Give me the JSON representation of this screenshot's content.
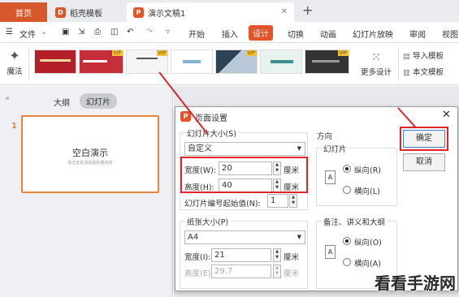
{
  "tabs": {
    "home": "首页",
    "templates": "稻壳模板",
    "doc": "演示文稿1",
    "add": "+"
  },
  "menu": {
    "file": "文件",
    "start": "开始",
    "insert": "插入",
    "design": "设计",
    "transition": "切换",
    "animation": "动画",
    "slideshow": "幻灯片放映",
    "review": "审阅",
    "view": "视图"
  },
  "ribbon": {
    "magic": "魔法",
    "vip": "VIP",
    "more": "更多设计",
    "import": "导入模板",
    "this_tpl": "本文模板"
  },
  "left": {
    "outline": "大纲",
    "slides": "幻灯片",
    "slide_num": "1",
    "slide_title": "空白演示",
    "slide_sub": "单击此处添加副标题内容"
  },
  "dialog": {
    "title": "页面设置",
    "slide_size_label": "幻灯片大小(S)",
    "slide_size_value": "自定义",
    "width_label": "宽度(W):",
    "width_value": "20",
    "height_label": "高度(H):",
    "height_value": "40",
    "unit": "厘米",
    "start_num_label": "幻灯片编号起始值(N):",
    "start_num_value": "1",
    "paper_label": "纸张大小(P)",
    "paper_value": "A4",
    "paper_width_label": "宽度(I):",
    "paper_width_value": "21",
    "paper_height_label": "高度(E):",
    "paper_height_value": "29.7",
    "orientation": "方向",
    "slides_group": "幻灯片",
    "portrait_r": "纵向(R)",
    "landscape_l": "横向(L)",
    "notes_group": "备注、讲义和大纲",
    "portrait_o": "纵向(O)",
    "landscape_a": "横向(A)",
    "ok": "确定",
    "cancel": "取消",
    "slides_orientation": "portrait",
    "notes_orientation": "portrait"
  },
  "watermark": "看看手游网",
  "colors": {
    "accent": "#e3542b",
    "highlight": "#e0242c"
  }
}
